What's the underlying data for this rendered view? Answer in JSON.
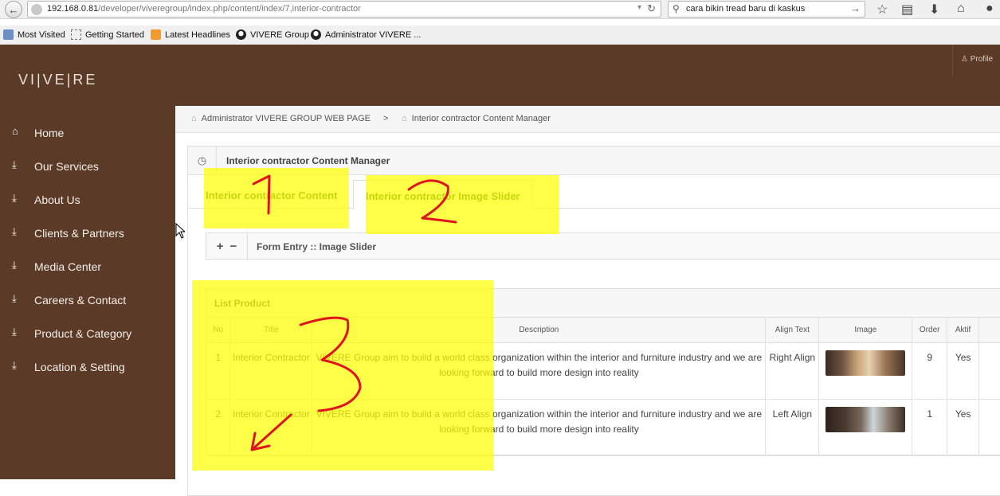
{
  "browser": {
    "url_host": "192.168.0.81",
    "url_path": "/developer/viveregroup/index.php/content/index/7,interior-contractor",
    "search_value": "cara bikin tread baru di kaskus",
    "bookmarks": [
      "Most Visited",
      "Getting Started",
      "Latest Headlines",
      "VIVERE Group",
      "Administrator VIVERE ..."
    ]
  },
  "app": {
    "logo": "VI|VE|RE",
    "profile_label": "Profile"
  },
  "sidebar": {
    "items": [
      {
        "label": "Home",
        "icon": "home-icon"
      },
      {
        "label": "Our Services",
        "icon": "download-circle-icon"
      },
      {
        "label": "About Us",
        "icon": "download-circle-icon"
      },
      {
        "label": "Clients & Partners",
        "icon": "download-circle-icon"
      },
      {
        "label": "Media Center",
        "icon": "download-circle-icon"
      },
      {
        "label": "Careers & Contact",
        "icon": "download-circle-icon"
      },
      {
        "label": "Product & Category",
        "icon": "download-circle-icon"
      },
      {
        "label": "Location & Setting",
        "icon": "download-circle-icon"
      }
    ]
  },
  "breadcrumb": {
    "root": "Administrator VIVERE GROUP WEB PAGE",
    "separator": ">",
    "current": "Interior contractor Content Manager"
  },
  "widget": {
    "title": "Interior contractor Content Manager",
    "tabs": [
      "Interior contractor Content",
      "Interior contractor Image Slider"
    ],
    "form_title": "Form Entry :: Image Slider",
    "list_title": "List Product"
  },
  "table": {
    "columns": [
      "No",
      "Title",
      "Description",
      "Align Text",
      "Image",
      "Order",
      "Aktif"
    ],
    "rows": [
      {
        "no": "1",
        "title": "Interior Contractor",
        "description": "VIVERE Group aim to build a world class organization within the interior and furniture industry and we are looking forward to build more design into reality",
        "align": "Right Align",
        "order": "9",
        "aktif": "Yes"
      },
      {
        "no": "2",
        "title": "Interior Contractor",
        "description": "VIVERE Group aim to build a world class organization within the interior and furniture industry and we are looking forward to build more design into reality",
        "align": "Left Align",
        "order": "1",
        "aktif": "Yes"
      }
    ]
  },
  "annotations": {
    "labels": [
      "1",
      "2",
      "3"
    ],
    "highlight_color": "#ffff00",
    "ink_color": "#e0141e"
  },
  "colors": {
    "brand_brown": "#5b3a28",
    "tab_green": "#2f6b2a"
  }
}
